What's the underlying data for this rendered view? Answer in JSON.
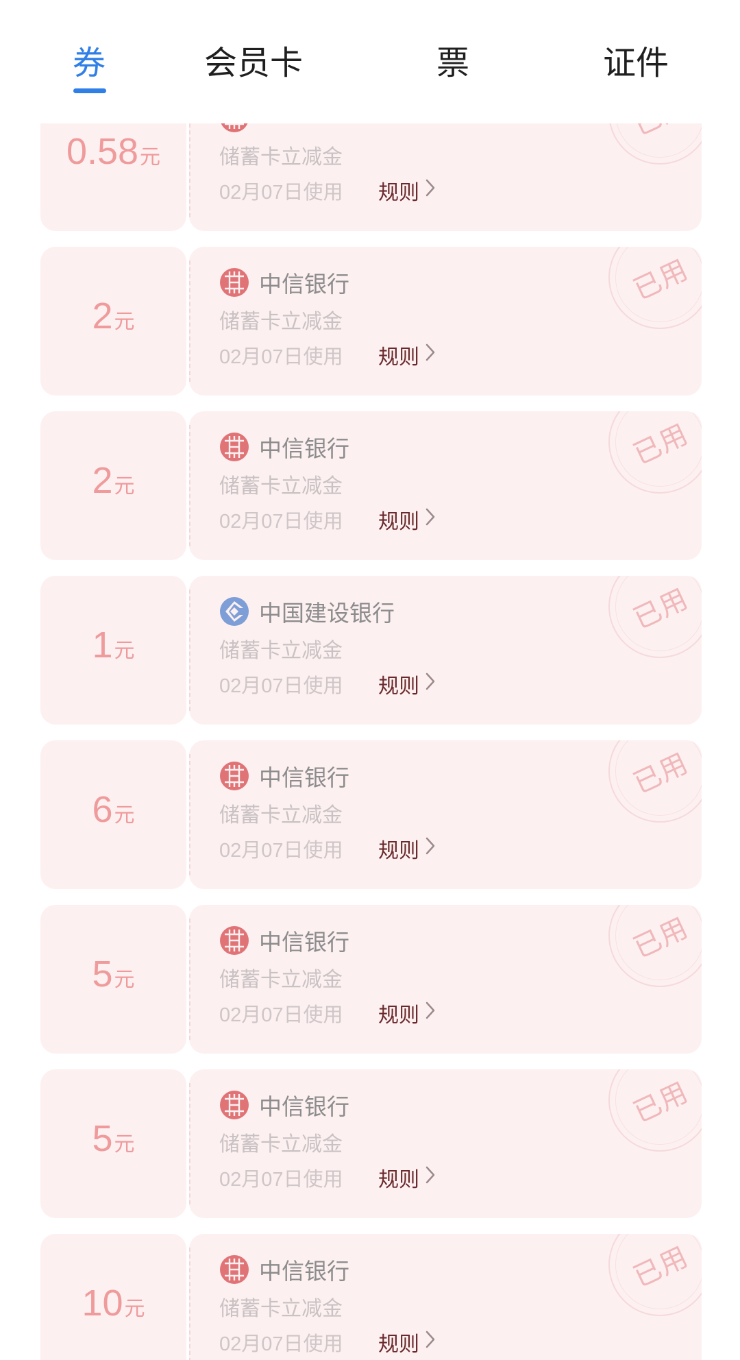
{
  "tabs": [
    {
      "label": "券",
      "active": true
    },
    {
      "label": "会员卡",
      "active": false
    },
    {
      "label": "票",
      "active": false
    },
    {
      "label": "证件",
      "active": false
    }
  ],
  "colors": {
    "accent": "#2f7fe6",
    "card_bg": "#fdf0f1",
    "amount": "#ef9b9c"
  },
  "coupons": [
    {
      "amount": "0.58",
      "unit": "元",
      "bank": "",
      "logo": "citic-bank-icon",
      "desc": "储蓄卡立减金",
      "date": "02月07日使用",
      "rule": "规则",
      "stamp": "已用"
    },
    {
      "amount": "2",
      "unit": "元",
      "bank": "中信银行",
      "logo": "citic-bank-icon",
      "desc": "储蓄卡立减金",
      "date": "02月07日使用",
      "rule": "规则",
      "stamp": "已用"
    },
    {
      "amount": "2",
      "unit": "元",
      "bank": "中信银行",
      "logo": "citic-bank-icon",
      "desc": "储蓄卡立减金",
      "date": "02月07日使用",
      "rule": "规则",
      "stamp": "已用"
    },
    {
      "amount": "1",
      "unit": "元",
      "bank": "中国建设银行",
      "logo": "ccb-bank-icon",
      "desc": "储蓄卡立减金",
      "date": "02月07日使用",
      "rule": "规则",
      "stamp": "已用"
    },
    {
      "amount": "6",
      "unit": "元",
      "bank": "中信银行",
      "logo": "citic-bank-icon",
      "desc": "储蓄卡立减金",
      "date": "02月07日使用",
      "rule": "规则",
      "stamp": "已用"
    },
    {
      "amount": "5",
      "unit": "元",
      "bank": "中信银行",
      "logo": "citic-bank-icon",
      "desc": "储蓄卡立减金",
      "date": "02月07日使用",
      "rule": "规则",
      "stamp": "已用"
    },
    {
      "amount": "5",
      "unit": "元",
      "bank": "中信银行",
      "logo": "citic-bank-icon",
      "desc": "储蓄卡立减金",
      "date": "02月07日使用",
      "rule": "规则",
      "stamp": "已用"
    },
    {
      "amount": "10",
      "unit": "元",
      "bank": "中信银行",
      "logo": "citic-bank-icon",
      "desc": "储蓄卡立减金",
      "date": "02月07日使用",
      "rule": "规则",
      "stamp": "已用"
    }
  ]
}
